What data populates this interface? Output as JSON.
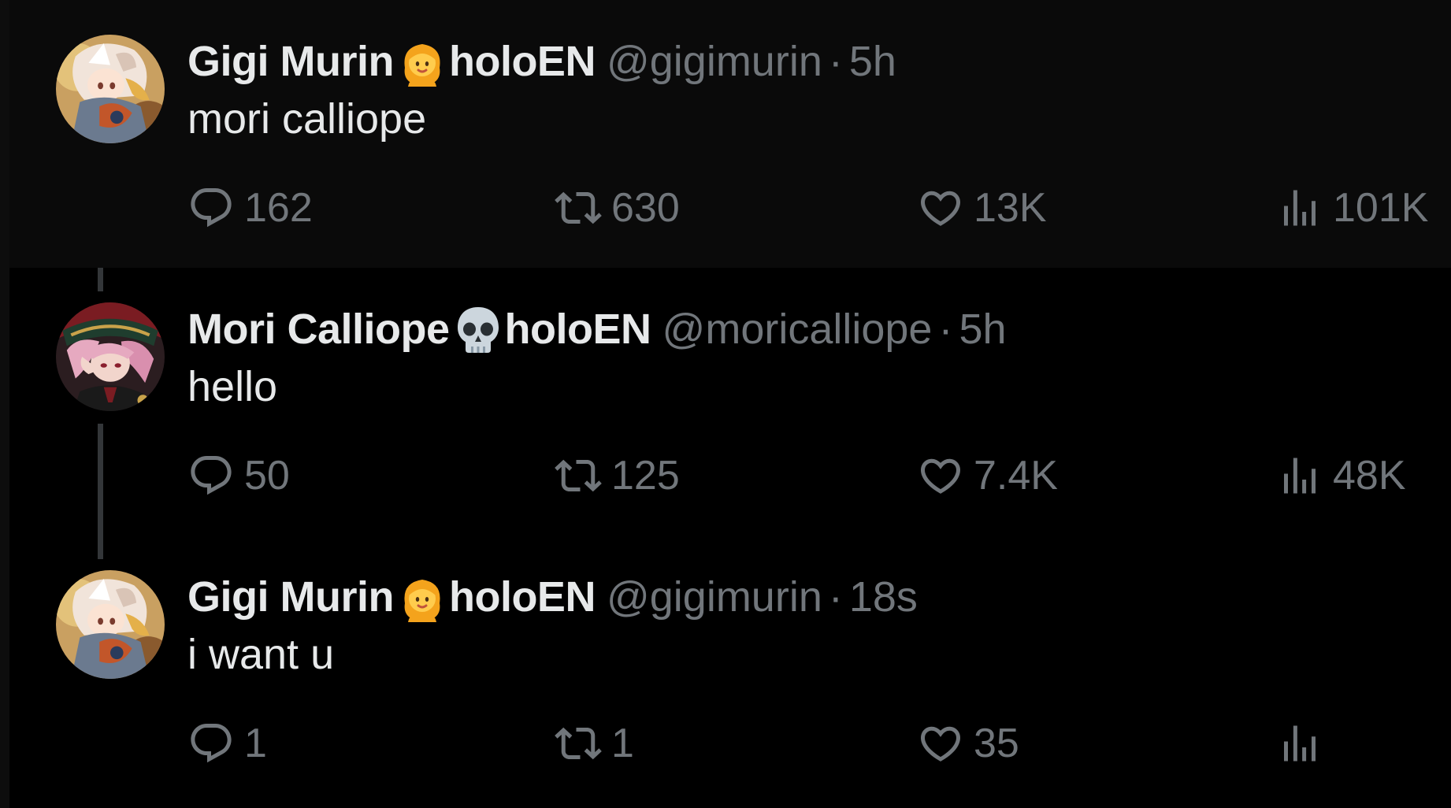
{
  "colors": {
    "background": "#000000",
    "highlight_background": "#0a0a0a",
    "primary_text": "#e7e9ea",
    "secondary_text": "#71767b",
    "thread_line": "#333639"
  },
  "tweets": [
    {
      "display_name": "Gigi Murin",
      "name_emoji": "person-emoji",
      "name_suffix": "holoEN",
      "handle": "@gigimurin",
      "separator": "·",
      "time": "5h",
      "text": "mori calliope",
      "replies": "162",
      "retweets": "630",
      "likes": "13K",
      "views": "101K"
    },
    {
      "display_name": "Mori Calliope",
      "name_emoji": "skull-emoji",
      "name_suffix": "holoEN",
      "handle": "@moricalliope",
      "separator": "·",
      "time": "5h",
      "text": "hello",
      "replies": "50",
      "retweets": "125",
      "likes": "7.4K",
      "views": "48K"
    },
    {
      "display_name": "Gigi Murin",
      "name_emoji": "person-emoji",
      "name_suffix": "holoEN",
      "handle": "@gigimurin",
      "separator": "·",
      "time": "18s",
      "text": "i want u",
      "replies": "1",
      "retweets": "1",
      "likes": "35",
      "views": ""
    }
  ]
}
